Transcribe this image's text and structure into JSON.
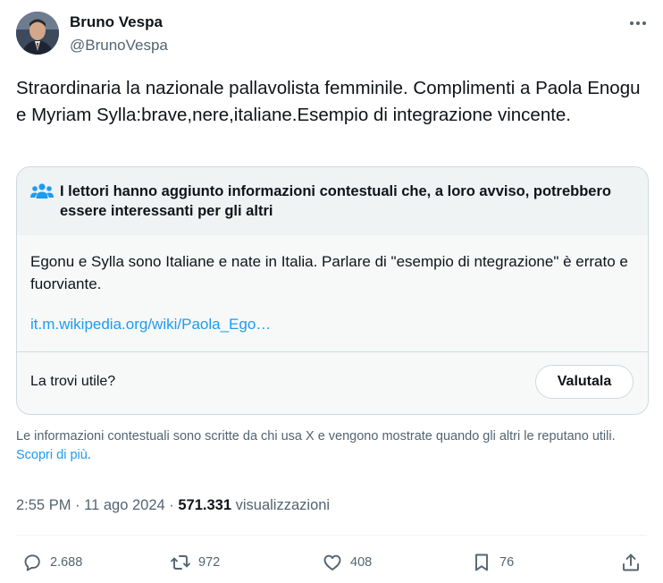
{
  "author": {
    "name": "Bruno Vespa",
    "handle": "@BrunoVespa"
  },
  "tweet": {
    "text": "Straordinaria la nazionale pallavolista femminile. Complimenti a Paola Enogu e Myriam Sylla:brave,nere,italiane.Esempio di integrazione vincente."
  },
  "community_note": {
    "title": "I lettori hanno aggiunto informazioni contestuali che, a loro avviso, potrebbero essere interessanti per gli altri",
    "body": "Egonu e Sylla sono Italiane e nate in Italia. Parlare di \"esempio di ntegrazione\" è errato e fuorviante.",
    "link": "it.m.wikipedia.org/wiki/Paola_Ego…",
    "helpful_question": "La trovi utile?",
    "rate_button": "Valutala"
  },
  "disclaimer": {
    "text": "Le informazioni contestuali sono scritte da chi usa X e vengono mostrate quando gli altri le reputano utili.",
    "link": "Scopri di più",
    "suffix": "."
  },
  "meta": {
    "time": "2:55 PM",
    "separator": "·",
    "date": "11 ago 2024",
    "views_count": "571.331",
    "views_label": "visualizzazioni"
  },
  "actions": {
    "replies": "2.688",
    "reposts": "972",
    "likes": "408",
    "bookmarks": "76"
  },
  "icons": {
    "more": "more-horizontal-icon",
    "community": "people-icon",
    "reply": "reply-icon",
    "repost": "repost-icon",
    "like": "heart-icon",
    "bookmark": "bookmark-icon",
    "share": "share-icon"
  },
  "colors": {
    "link": "#1d9bf0",
    "secondary_text": "#536471",
    "primary_text": "#0f1419",
    "border": "#cfd9de"
  }
}
